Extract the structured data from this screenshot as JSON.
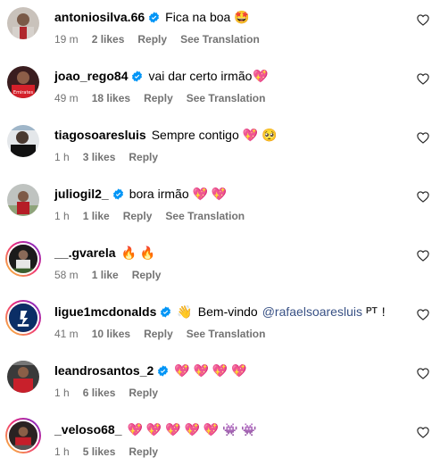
{
  "colors": {
    "verified_blue": "#0095f6",
    "meta_gray": "#737373",
    "mention_blue": "#385185",
    "heart_red": "#e8264e"
  },
  "comments": [
    {
      "username": "antoniosilva.66",
      "verified": true,
      "text": "Fica na boa",
      "emoji": "🤩",
      "time": "19 m",
      "likes": "2 likes",
      "reply": "Reply",
      "translation": "See Translation"
    },
    {
      "username": "joao_rego84",
      "verified": true,
      "text": "vai dar certo irmão",
      "emoji": "💖",
      "time": "49 m",
      "likes": "18 likes",
      "reply": "Reply",
      "translation": "See Translation"
    },
    {
      "username": "tiagosoaresluis",
      "verified": false,
      "text": "Sempre contigo",
      "emoji": "💖 🥺",
      "time": "1 h",
      "likes": "3 likes",
      "reply": "Reply",
      "translation": ""
    },
    {
      "username": "juliogil2_",
      "verified": true,
      "text": "bora irmão",
      "emoji": "💖 💖",
      "time": "1 h",
      "likes": "1 like",
      "reply": "Reply",
      "translation": "See Translation"
    },
    {
      "username": "__.gvarela",
      "verified": false,
      "text": "",
      "emoji": "🔥 🔥",
      "time": "58 m",
      "likes": "1 like",
      "reply": "Reply",
      "translation": ""
    },
    {
      "username": "ligue1mcdonalds",
      "verified": true,
      "text": "Bem-vindo",
      "pre_emoji": "👋",
      "mention": "@rafaelsoaresluis",
      "flag": "PT",
      "suffix": "!",
      "time": "41 m",
      "likes": "10 likes",
      "reply": "Reply",
      "translation": "See Translation"
    },
    {
      "username": "leandrosantos_2",
      "verified": true,
      "text": "",
      "emoji": "💖 💖 💖 💖",
      "time": "1 h",
      "likes": "6 likes",
      "reply": "Reply",
      "translation": ""
    },
    {
      "username": "_veloso68_",
      "verified": false,
      "text": "",
      "emoji": "💖 💖 💖 💖 💖 👾 👾",
      "time": "1 h",
      "likes": "5 likes",
      "reply": "Reply",
      "translation": ""
    }
  ]
}
